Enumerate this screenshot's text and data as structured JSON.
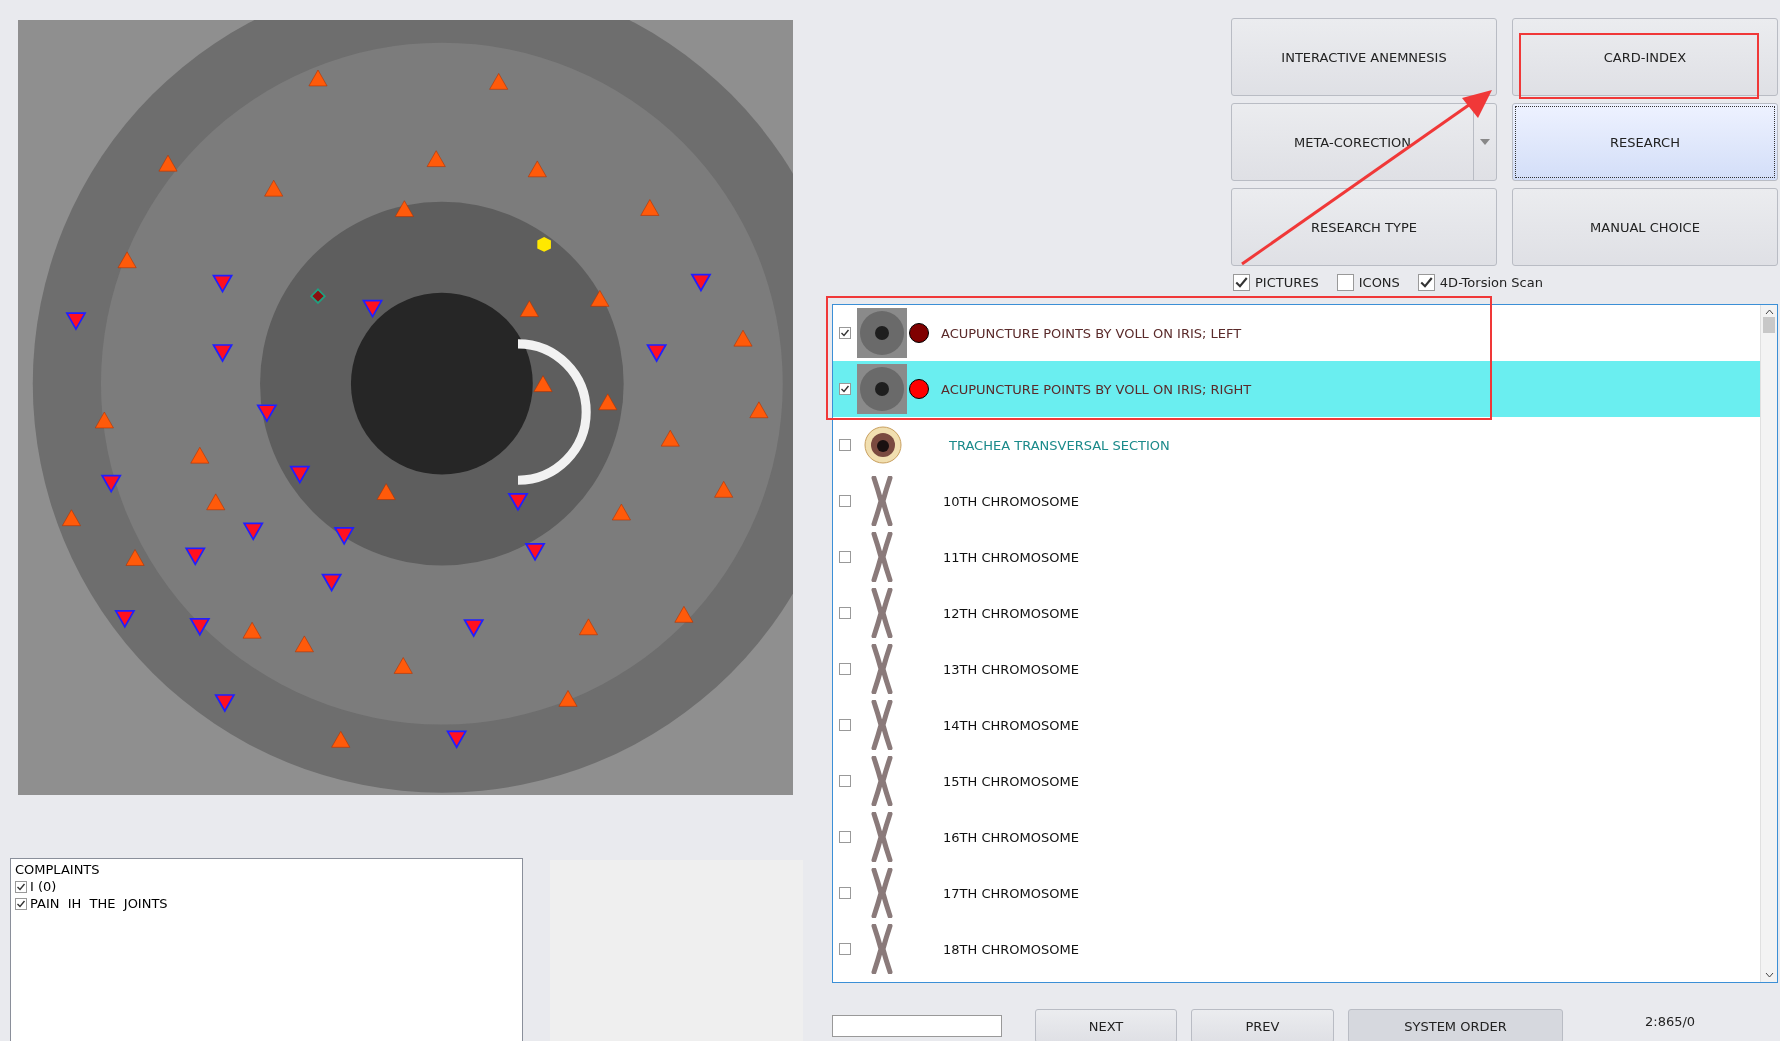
{
  "action_buttons": [
    {
      "label": "INTERACTIVE ANEMNESIS",
      "selected": false,
      "dropdown": false
    },
    {
      "label": "CARD-INDEX",
      "selected": false,
      "dropdown": false
    },
    {
      "label": "META-CORECTION",
      "selected": false,
      "dropdown": true
    },
    {
      "label": "RESEARCH",
      "selected": true,
      "dropdown": false
    },
    {
      "label": "RESEARCH TYPE",
      "selected": false,
      "dropdown": false
    },
    {
      "label": "MANUAL CHOICE",
      "selected": false,
      "dropdown": false
    }
  ],
  "options": [
    {
      "label": "PICTURES",
      "checked": true
    },
    {
      "label": "ICONS",
      "checked": false
    },
    {
      "label": "4D-Torsion Scan",
      "checked": true
    }
  ],
  "research_list": [
    {
      "kind": "iris",
      "label": "ACUPUNCTURE POINTS BY VOLL ON IRIS; LEFT",
      "checked": true,
      "selected": false,
      "color": "#800000"
    },
    {
      "kind": "iris",
      "label": "ACUPUNCTURE POINTS BY VOLL ON IRIS; RIGHT",
      "checked": true,
      "selected": true,
      "color": "#ff0000"
    },
    {
      "kind": "trachea",
      "label": "TRACHEA TRANSVERSAL SECTION",
      "checked": false,
      "selected": false
    },
    {
      "kind": "chromosome",
      "label": "10TH CHROMOSOME",
      "checked": false,
      "selected": false
    },
    {
      "kind": "chromosome",
      "label": "11TH CHROMOSOME",
      "checked": false,
      "selected": false
    },
    {
      "kind": "chromosome",
      "label": "12TH CHROMOSOME",
      "checked": false,
      "selected": false
    },
    {
      "kind": "chromosome",
      "label": "13TH CHROMOSOME",
      "checked": false,
      "selected": false
    },
    {
      "kind": "chromosome",
      "label": "14TH CHROMOSOME",
      "checked": false,
      "selected": false
    },
    {
      "kind": "chromosome",
      "label": "15TH CHROMOSOME",
      "checked": false,
      "selected": false
    },
    {
      "kind": "chromosome",
      "label": "16TH CHROMOSOME",
      "checked": false,
      "selected": false
    },
    {
      "kind": "chromosome",
      "label": "17TH CHROMOSOME",
      "checked": false,
      "selected": false
    },
    {
      "kind": "chromosome",
      "label": "18TH CHROMOSOME",
      "checked": false,
      "selected": false
    }
  ],
  "complaints": {
    "title": "COMPLAINTS",
    "items": [
      {
        "label": "I (0)",
        "checked": true
      },
      {
        "label": "PAIN  IH  THE  JOINTS",
        "checked": true
      }
    ]
  },
  "nav_buttons": [
    {
      "label": "NEXT",
      "selected": false
    },
    {
      "label": "PREV",
      "selected": false
    },
    {
      "label": "SYSTEM ORDER",
      "selected": true
    }
  ],
  "counter": "2:865/0"
}
